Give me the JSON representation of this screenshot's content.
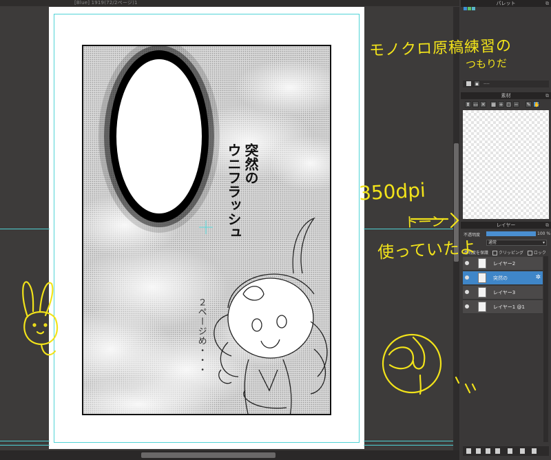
{
  "window": {
    "document_tab": "[Blue] 1919(72/2ページ)1"
  },
  "canvas": {
    "speech_lines": [
      "突然の",
      "ウニフラッシュ"
    ],
    "frame_note": "２ページめ・・・"
  },
  "panels": {
    "palette": {
      "title": "パレット",
      "footer_text": "----"
    },
    "material": {
      "title": "素材"
    },
    "layer": {
      "title": "レイヤー",
      "opacity_label": "不透明度",
      "opacity_value": "100 %",
      "opacity_fraction": 1.0,
      "blend_mode": "通常",
      "protect_label": "透明度を保護",
      "clipping_label": "クリッピング",
      "lock_label": "ロック",
      "layers": [
        {
          "name": "レイヤー2",
          "selected": false,
          "gear": ""
        },
        {
          "name": "突然の",
          "selected": true,
          "gear": "✲"
        },
        {
          "name": "レイヤー3",
          "selected": false,
          "gear": ""
        },
        {
          "name": "レイヤー1 @1",
          "selected": false,
          "gear": ""
        }
      ]
    }
  },
  "annotations": {
    "monochrome_line1": "モノクロ原稿練習の",
    "monochrome_line2": "つもりだ",
    "dpi": "350dpi",
    "tone": "トーン",
    "used": "使っていたよ"
  },
  "colors": {
    "annotation": "#f2e31a",
    "selection": "#3f86c8",
    "guide": "#4fd3d6"
  }
}
